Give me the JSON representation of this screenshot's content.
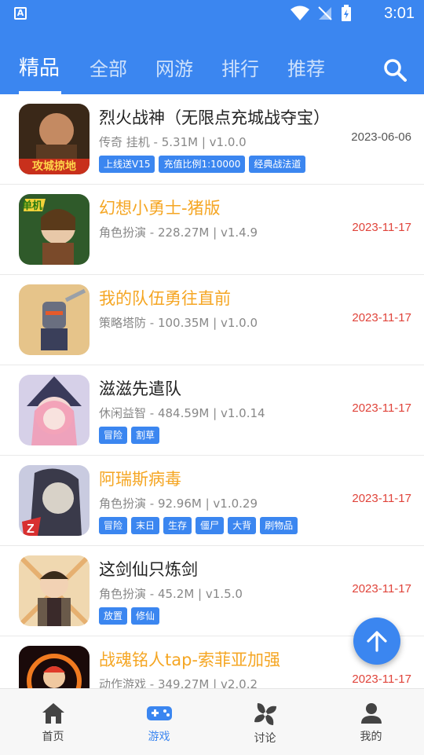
{
  "status": {
    "time": "3:01"
  },
  "tabs": [
    "精品",
    "全部",
    "网游",
    "排行",
    "推荐"
  ],
  "games": [
    {
      "title": "烈火战神（无限点充城战夺宝）",
      "meta": "传奇 挂机 - 5.31M | v1.0.0",
      "date": "2023-06-06",
      "tags": [
        "上线送V15",
        "充值比例1:10000",
        "经典战法道"
      ]
    },
    {
      "title": "幻想小勇士-猪版",
      "meta": "角色扮演 - 228.27M | v1.4.9",
      "date": "2023-11-17",
      "tags": []
    },
    {
      "title": "我的队伍勇往直前",
      "meta": "策略塔防 - 100.35M | v1.0.0",
      "date": "2023-11-17",
      "tags": []
    },
    {
      "title": "滋滋先遣队",
      "meta": "休闲益智 - 484.59M | v1.0.14",
      "date": "2023-11-17",
      "tags": [
        "冒险",
        "割草"
      ]
    },
    {
      "title": "阿瑞斯病毒",
      "meta": "角色扮演 - 92.96M | v1.0.29",
      "date": "2023-11-17",
      "tags": [
        "冒险",
        "末日",
        "生存",
        "僵尸",
        "大背",
        "刷物品"
      ]
    },
    {
      "title": "这剑仙只炼剑",
      "meta": "角色扮演 - 45.2M | v1.5.0",
      "date": "2023-11-17",
      "tags": [
        "放置",
        "修仙"
      ]
    },
    {
      "title": "战魂铭人tap-索菲亚加强",
      "meta": "动作游戏 - 349.27M | v2.0.2",
      "date": "2023-11-17",
      "tags": []
    }
  ],
  "thumb_text": {
    "t0": "攻城掠地",
    "t1": "单机"
  },
  "nav": [
    "首页",
    "游戏",
    "讨论",
    "我的"
  ],
  "colors": {
    "primary": "#3b86f0",
    "highlight": "#f5a623",
    "date": "#e0433a"
  }
}
